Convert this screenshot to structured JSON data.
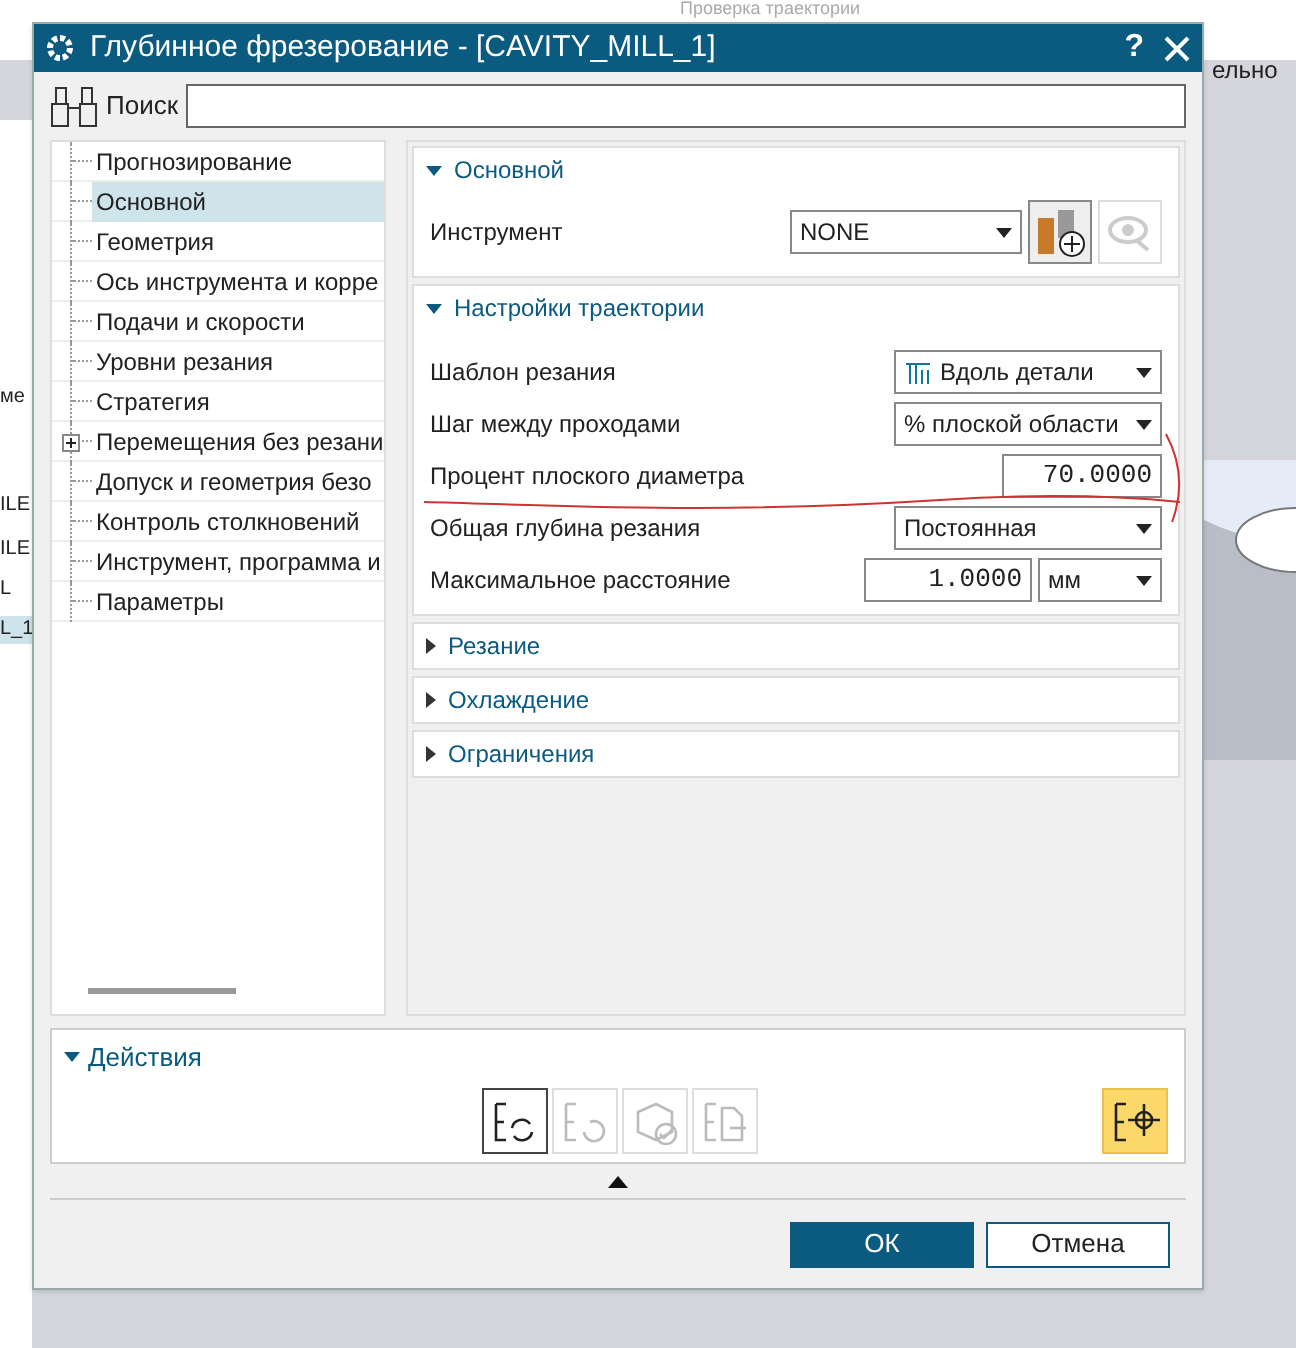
{
  "background_app": {
    "toolbar_label": "Проверка траектории",
    "right_label": "ельно",
    "left_cells": [
      "ме",
      "ILE",
      "ILE",
      "L",
      "L_1"
    ]
  },
  "window": {
    "title": "Глубинное фрезерование - [CAVITY_MILL_1]",
    "help": "?"
  },
  "search": {
    "label": "Поиск"
  },
  "tree": [
    {
      "label": "Прогнозирование",
      "selected": false
    },
    {
      "label": "Основной",
      "selected": true
    },
    {
      "label": "Геометрия",
      "selected": false
    },
    {
      "label": "Ось инструмента и корре",
      "selected": false
    },
    {
      "label": "Подачи и скорости",
      "selected": false
    },
    {
      "label": "Уровни резания",
      "selected": false
    },
    {
      "label": "Стратегия",
      "selected": false
    },
    {
      "label": "Перемещения без резани",
      "selected": false,
      "expanded": false
    },
    {
      "label": "Допуск и геометрия безо",
      "selected": false
    },
    {
      "label": "Контроль столкновений",
      "selected": false
    },
    {
      "label": "Инструмент, программа и",
      "selected": false
    },
    {
      "label": "Параметры",
      "selected": false
    }
  ],
  "sections": [
    {
      "title": "Основной",
      "expanded": true,
      "rows": [
        {
          "kind": "tool",
          "label": "Инструмент",
          "value": "NONE"
        }
      ]
    },
    {
      "title": "Настройки траектории",
      "expanded": true,
      "rows": [
        {
          "kind": "dropdown",
          "label": "Шаблон резания",
          "value": "Вдоль детали",
          "icon": true
        },
        {
          "kind": "dropdown",
          "label": "Шаг между проходами",
          "value": "% плоской области"
        },
        {
          "kind": "number",
          "label": "Процент плоского диаметра",
          "value": "70.0000"
        },
        {
          "kind": "dropdown",
          "label": "Общая глубина резания",
          "value": "Постоянная"
        },
        {
          "kind": "number_unit",
          "label": "Максимальное расстояние",
          "value": "1.0000",
          "unit": "мм"
        }
      ]
    },
    {
      "title": "Резание",
      "expanded": false
    },
    {
      "title": "Охлаждение",
      "expanded": false
    },
    {
      "title": "Ограничения",
      "expanded": false
    }
  ],
  "actions": {
    "title": "Действия",
    "expanded": true,
    "buttons": [
      {
        "kind": "generate",
        "disabled": false
      },
      {
        "kind": "replay",
        "disabled": true
      },
      {
        "kind": "verify",
        "disabled": true
      },
      {
        "kind": "list",
        "disabled": true
      },
      {
        "kind": "locate",
        "disabled": false,
        "selected": true
      }
    ]
  },
  "buttons": [
    {
      "label": "ОК",
      "kind": "primary"
    },
    {
      "label": "Отмена",
      "kind": "secondary"
    }
  ]
}
